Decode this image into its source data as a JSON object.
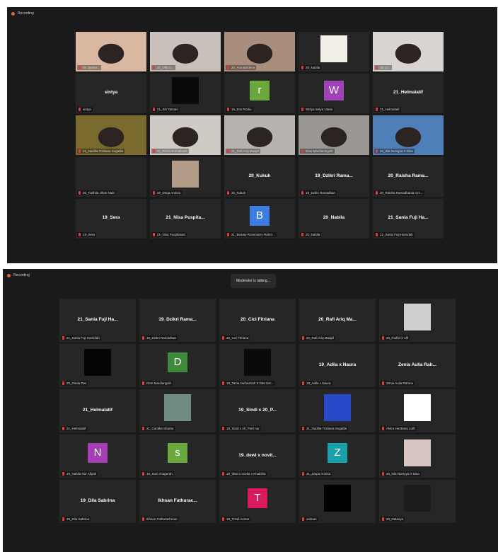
{
  "colors": {
    "window_bg": "#1a1a1a",
    "tile_bg": "#262626",
    "active_border": "#c6d94a",
    "recording_dot": "#e0683b",
    "muted_mic": "#e33b3b"
  },
  "windows": [
    {
      "recording_label": "Recording",
      "banner": "",
      "tiles": [
        {
          "type": "video",
          "display": "",
          "caption": "Sri Jaraha...",
          "active": true,
          "scene": "#d8b8a0"
        },
        {
          "type": "video",
          "display": "",
          "caption": "21_Ulfa U...",
          "scene": "#c9c0bb"
        },
        {
          "type": "video",
          "display": "",
          "caption": "20_Ana Beldene",
          "scene": "#a98e7d"
        },
        {
          "type": "photo",
          "display": "",
          "caption": "20_Nabila",
          "photo_color": "#f1efe8",
          "photo_icon": "cartoon-photo"
        },
        {
          "type": "video",
          "display": "",
          "caption": "19_Lt...",
          "scene": "#d9d4d0"
        },
        {
          "type": "name",
          "display": "sintya",
          "caption": "sintya"
        },
        {
          "type": "photo",
          "display": "",
          "caption": "21_Siti Yatsairi",
          "photo_color": "#0a0a0a",
          "photo_icon": "black-photo"
        },
        {
          "type": "avatar",
          "display": "r",
          "caption": "19_Ena Rodiu",
          "avatar_color": "#6aa83d"
        },
        {
          "type": "avatar",
          "display": "W",
          "caption": "Widya Setya Utami",
          "avatar_color": "#a143b8"
        },
        {
          "type": "name",
          "display": "21_Helmalatif",
          "caption": "21_Helmalatif"
        },
        {
          "type": "video",
          "display": "",
          "caption": "21_Nadilla Tristiana Sugatila",
          "scene": "#7a6a2e"
        },
        {
          "type": "video",
          "display": "",
          "caption": "21_Rizza Nurhalimah",
          "scene": "#cfcac4"
        },
        {
          "type": "video",
          "display": "",
          "caption": "21_Rafi Ariq Maajid",
          "scene": "#b7b3ae"
        },
        {
          "type": "video",
          "display": "",
          "caption": "Dian Mardianingsih",
          "scene": "#9a9795"
        },
        {
          "type": "video",
          "display": "",
          "caption": "20_Ikla Nurayya X Elsa",
          "scene": "#4f7fb8"
        },
        {
          "type": "empty",
          "display": "",
          "caption": "20_Fadhila Jihan Nabi"
        },
        {
          "type": "photo",
          "display": "",
          "caption": "20_Deqa Annisa",
          "photo_color": "#b29c88",
          "photo_icon": "person-photo"
        },
        {
          "type": "name",
          "display": "20_Kukuh",
          "caption": "20_Kukuh"
        },
        {
          "type": "name",
          "display": "19_Dzikri Rama...",
          "caption": "19_Dzikri Ramadhan"
        },
        {
          "type": "name",
          "display": "20_Raisha Rama...",
          "caption": "20_Raisha Ramadhania Azz..."
        },
        {
          "type": "name",
          "display": "19_Sera",
          "caption": "19_Sera"
        },
        {
          "type": "name",
          "display": "21_Nisa Puspita...",
          "caption": "21_Nisa Puspitasari"
        },
        {
          "type": "avatar",
          "display": "B",
          "caption": "21_Beauty Rosemarry Rahm...",
          "avatar_color": "#3d7ce0"
        },
        {
          "type": "name",
          "display": "20_Nabila",
          "caption": "20_Nabila"
        },
        {
          "type": "name",
          "display": "21_Sania Fuji Ha...",
          "caption": "21_Sania Fuji Hamidah"
        }
      ]
    },
    {
      "recording_label": "Recording",
      "banner": "Moderator is talking...",
      "tiles": [
        {
          "type": "name",
          "display": "21_Sania Fuji Ha...",
          "caption": "21_Sania Fuji Hamidah"
        },
        {
          "type": "name",
          "display": "19_Dzikri Rama...",
          "caption": "19_Dzikri Ramadhan"
        },
        {
          "type": "name",
          "display": "20_Cici Fitriana",
          "caption": "20_Cici Fitriana"
        },
        {
          "type": "name",
          "display": "20_Rafi Ariq Ma...",
          "caption": "20_Rafi Ariq Maajid"
        },
        {
          "type": "photo",
          "display": "",
          "caption": "20_Fadhil X Alfi",
          "photo_color": "#cfcfcf",
          "photo_icon": "statue-photo"
        },
        {
          "type": "photo",
          "display": "",
          "caption": "20_Dinda Dwi",
          "photo_color": "#050505",
          "photo_icon": "black-photo"
        },
        {
          "type": "avatar",
          "display": "D",
          "caption": "Dian Mardiangsih",
          "avatar_color": "#3f8a3a"
        },
        {
          "type": "photo",
          "display": "",
          "caption": "19_Tania Nurfauziah X Dita Sor...",
          "photo_color": "#0a0a0a",
          "photo_icon": "black-photo"
        },
        {
          "type": "name",
          "display": "19_Adila x Naura",
          "caption": "19_Adila x Naura"
        },
        {
          "type": "name",
          "display": "Zenia Aulia Rah...",
          "caption": "Zenia Aulia Rahma"
        },
        {
          "type": "name",
          "display": "21_Helmalatif",
          "caption": "21_Helmalatif"
        },
        {
          "type": "photo",
          "display": "",
          "caption": "21_Cantika Shania",
          "photo_color": "#6f8c83",
          "photo_icon": "friends-photo"
        },
        {
          "type": "name",
          "display": "19_Sindi x 20_P...",
          "caption": "19_Sindi x 20_Putri nur"
        },
        {
          "type": "photo",
          "display": "",
          "caption": "21_Nadilla Tristiana Sugatila",
          "photo_color": "#2a49c9",
          "photo_icon": "portrait-photo"
        },
        {
          "type": "photo",
          "display": "",
          "caption": "Alvira Herdiana Lutfi",
          "photo_color": "#ffffff",
          "photo_icon": "white-photo"
        },
        {
          "type": "avatar",
          "display": "N",
          "caption": "19_Nabila Nur Afiyah",
          "avatar_color": "#a13fb3"
        },
        {
          "type": "avatar",
          "display": "s",
          "caption": "19_Suci Anugerah",
          "avatar_color": "#6aa83d"
        },
        {
          "type": "name",
          "display": "19_dewi x novit...",
          "caption": "19_dewi x novita x Khalisha"
        },
        {
          "type": "avatar",
          "display": "Z",
          "caption": "21_Zarpa Annisa",
          "avatar_color": "#1aa0a8"
        },
        {
          "type": "photo",
          "display": "",
          "caption": "20_Ikla Nurayya X Elsa",
          "photo_color": "#d8c4c0",
          "photo_icon": "hijab-photo"
        },
        {
          "type": "name",
          "display": "19_Dila Sabrina",
          "caption": "19_Dila Sabrina"
        },
        {
          "type": "name",
          "display": "Ikhsan Fathurac...",
          "caption": "Ikhsan Fathurachman"
        },
        {
          "type": "avatar",
          "display": "T",
          "caption": "19_Trisdi Asmar",
          "avatar_color": "#d81b5e"
        },
        {
          "type": "photo",
          "display": "",
          "caption": "salman",
          "photo_color": "#000000",
          "photo_icon": "black-photo"
        },
        {
          "type": "photo",
          "display": "",
          "caption": "20_Natasya",
          "photo_color": "#1c1c1c",
          "photo_icon": "silhouette-photo"
        }
      ]
    }
  ]
}
